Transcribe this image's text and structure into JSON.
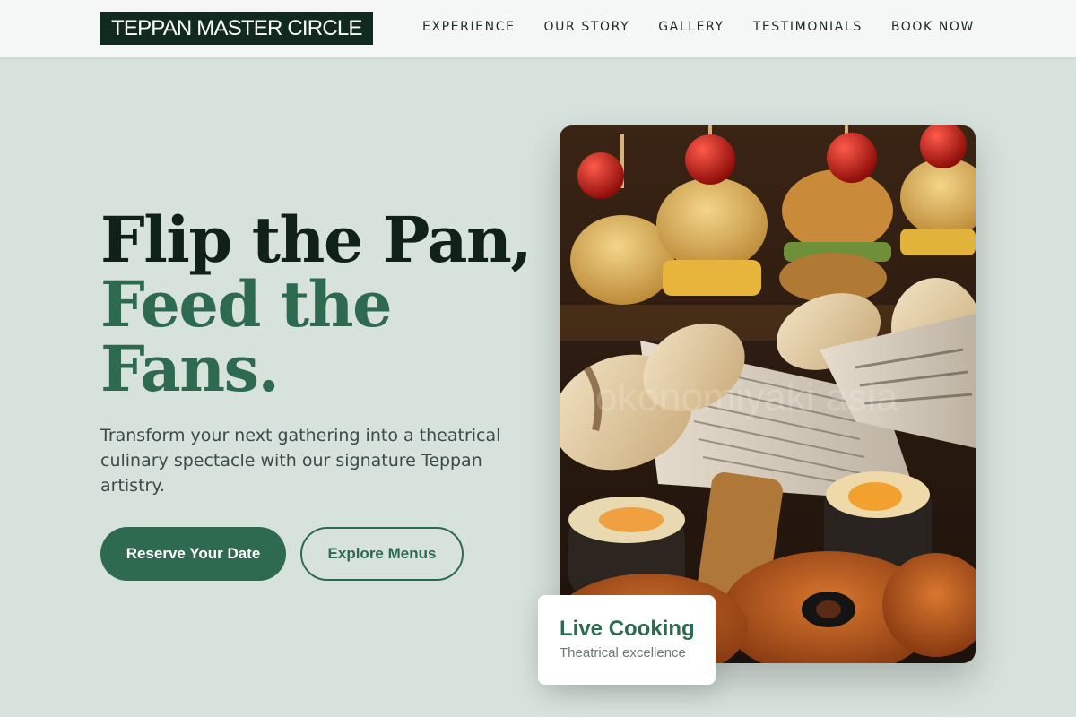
{
  "brand": {
    "name": "TEPPAN MASTER CIRCLE"
  },
  "nav": {
    "items": [
      {
        "label": "EXPERIENCE"
      },
      {
        "label": "OUR STORY"
      },
      {
        "label": "GALLERY"
      },
      {
        "label": "TESTIMONIALS"
      },
      {
        "label": "BOOK NOW"
      }
    ]
  },
  "hero": {
    "headline_line1": "Flip the Pan,",
    "headline_line2": "Feed the",
    "headline_line3": "Fans.",
    "subtitle": "Transform your next gathering into a theatrical culinary spectacle with our signature Teppan artistry.",
    "primary_button": "Reserve Your Date",
    "secondary_button": "Explore Menus"
  },
  "image": {
    "subject": "teppan-food-platter",
    "watermark": "okonomiyaki asia"
  },
  "badge": {
    "title": "Live Cooking",
    "subtitle": "Theatrical excellence"
  },
  "colors": {
    "background": "#d8e2dc",
    "accent": "#2d6a4f",
    "dark": "#0f2119",
    "header_bg": "#f4f7f5"
  }
}
